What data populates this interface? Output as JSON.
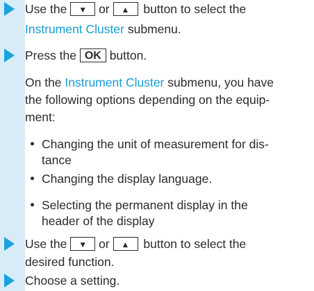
{
  "steps": {
    "s1": {
      "pre": "Use the",
      "key_down": "▼",
      "or": "or",
      "key_up": "▲",
      "post": "button to select the",
      "line2_link": "Instrument Cluster",
      "line2_post": "submenu."
    },
    "s2": {
      "pre": "Press the",
      "key_ok": "OK",
      "post": "button."
    },
    "info": {
      "l1_pre": "On the",
      "l1_link": "Instrument Cluster",
      "l1_post": "submenu, you have",
      "l2": "the following options depending on the equip-",
      "l3": "ment:"
    },
    "bullets": {
      "b1_l1": "Changing the unit of measurement for dis-",
      "b1_l2": "tance",
      "b2_l1": "Changing the display language.",
      "b3_l1": "Selecting the permanent display in the",
      "b3_l2": "header of the display"
    },
    "s3": {
      "pre": "Use the",
      "key_down": "▼",
      "or": "or",
      "key_up": "▲",
      "post": "button to select the",
      "l2": "desired function."
    },
    "s4": {
      "text": "Choose a setting."
    }
  },
  "colors": {
    "accent": "#1a9bd6",
    "stripe": "#d8ecf7"
  }
}
